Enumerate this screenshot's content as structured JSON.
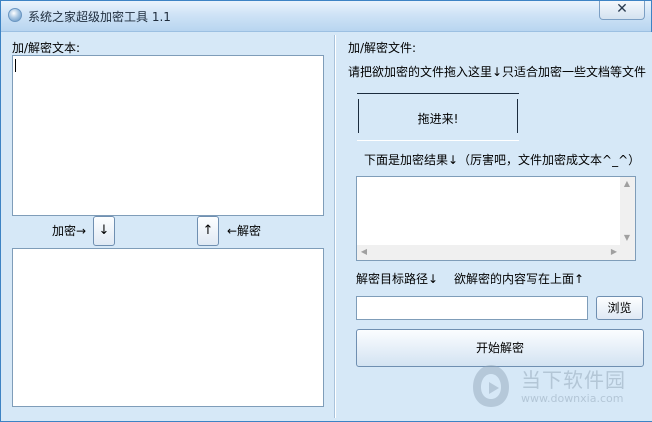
{
  "window": {
    "title": "系统之家超级加密工具 1.1",
    "close_label": "✕"
  },
  "left_panel": {
    "text_label": "加/解密文本:",
    "input_text": "",
    "output_text": "",
    "encrypt_label": "加密→",
    "encrypt_arrow": "↓",
    "decrypt_label": "←解密",
    "decrypt_arrow": "↑"
  },
  "right_panel": {
    "file_label": "加/解密文件:",
    "drag_instruction": "请把欲加密的文件拖入这里↓只适合加密一些文档等文件",
    "drop_zone_text": "拖进来!",
    "result_label": "下面是加密结果↓（厉害吧，文件加密成文本^_^）",
    "result_text": "",
    "path_label": "解密目标路径↓",
    "content_hint": "欲解密的内容写在上面↑",
    "path_value": "",
    "browse_label": "浏览",
    "start_label": "开始解密"
  },
  "watermark": {
    "brand": "当下软件园",
    "url": "www.downxia.com"
  }
}
